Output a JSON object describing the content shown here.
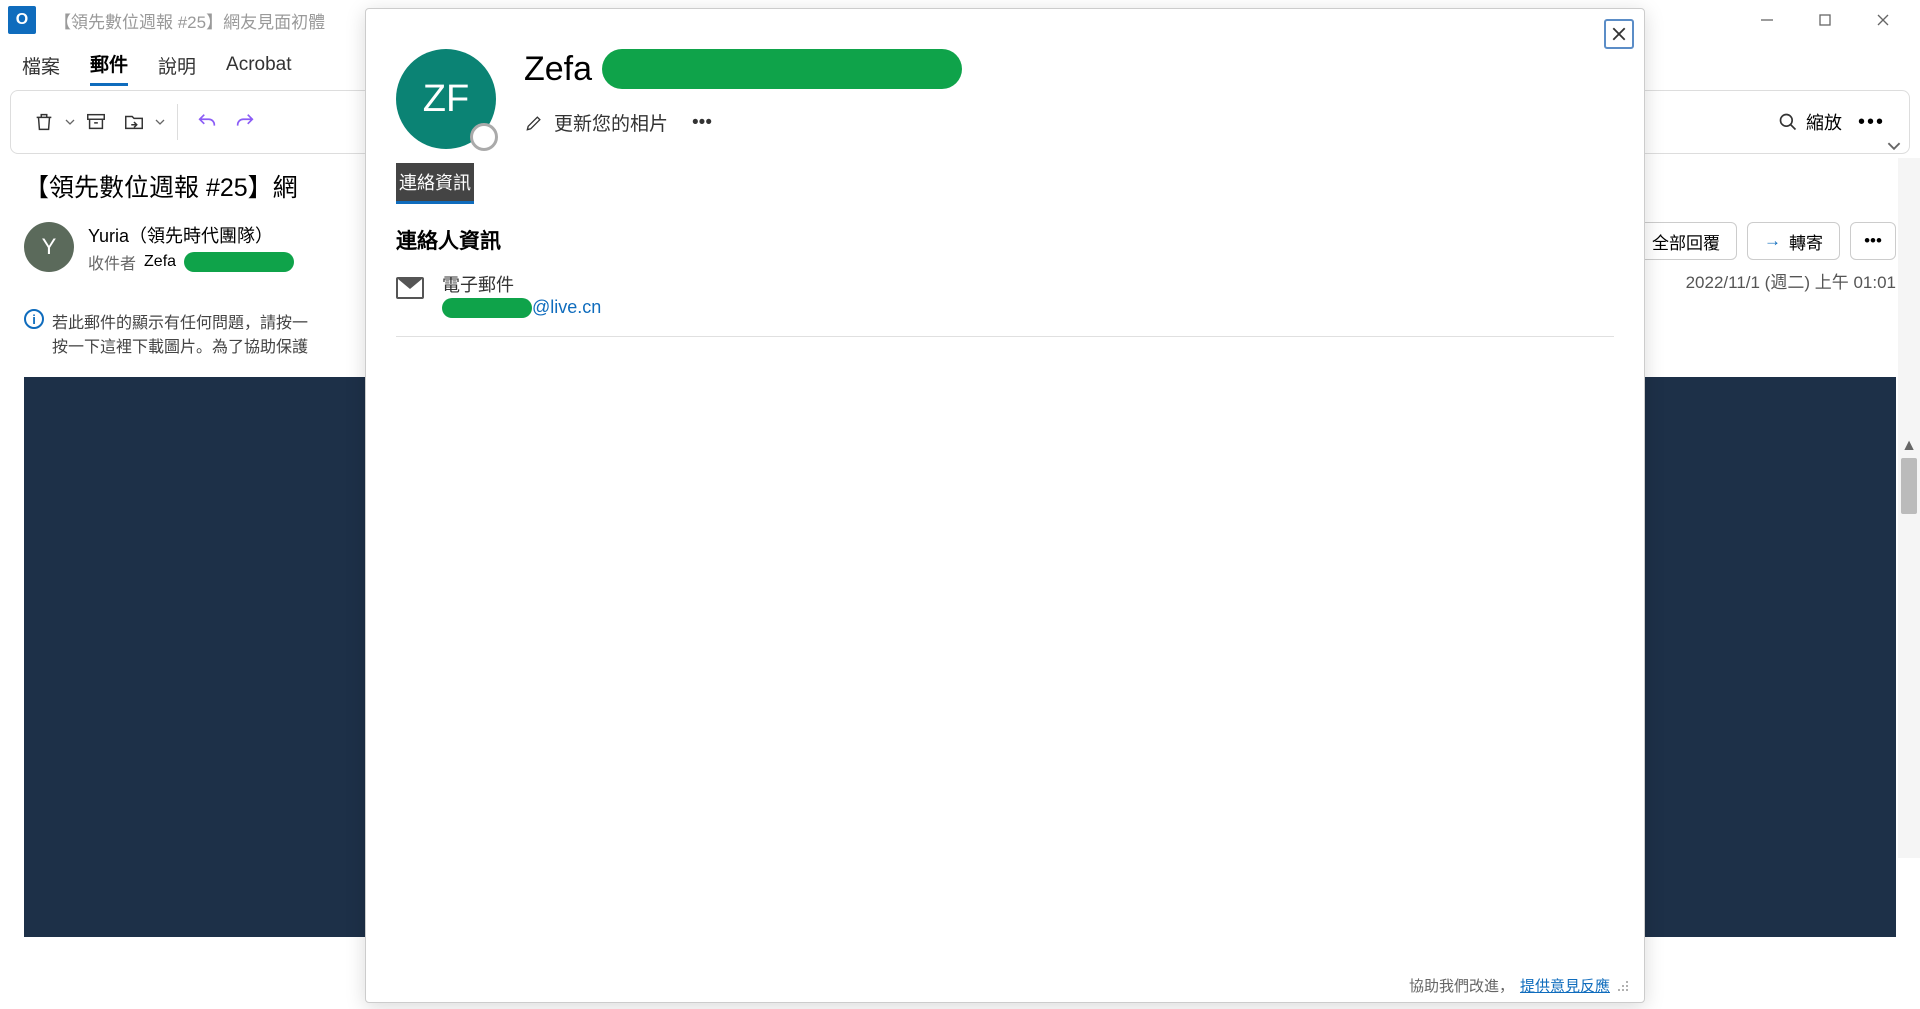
{
  "title": "【領先數位週報 #25】網友見面初體",
  "tabs": {
    "file": "檔案",
    "mail": "郵件",
    "help": "說明",
    "acrobat": "Acrobat"
  },
  "toolbar": {
    "zoom": "縮放"
  },
  "message": {
    "subject_prefix": "【領先數位週報 #25】網",
    "sender": "Yuria（領先時代團隊）",
    "sender_initial": "Y",
    "recipient_label": "收件者",
    "recipient_name": "Zefa",
    "timestamp": "2022/11/1 (週二) 上午 01:01",
    "actions": {
      "reply_all": "全部回覆",
      "forward": "轉寄"
    },
    "info_line1": "若此郵件的顯示有任何問題，請按一",
    "info_line2": "按一下這裡下載圖片。為了協助保護"
  },
  "contact_card": {
    "initials": "ZF",
    "name": "Zefa",
    "update_photo": "更新您的相片",
    "tab_contact": "連絡資訊",
    "section_title": "連絡人資訊",
    "email_label": "電子郵件",
    "email_domain": "@live.cn",
    "footer_text": "協助我們改進，",
    "footer_link": "提供意見反應"
  }
}
